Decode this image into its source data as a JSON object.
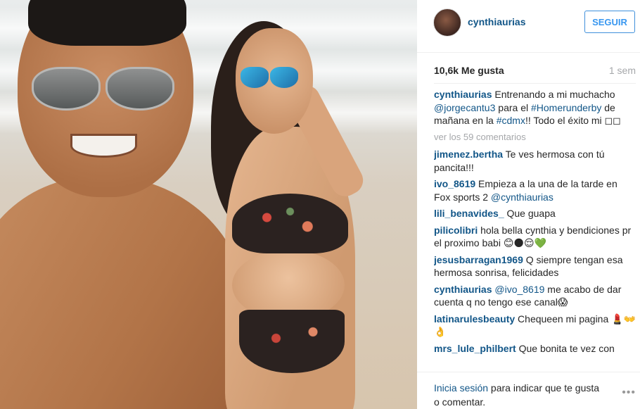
{
  "post": {
    "username": "cynthiaurias",
    "follow_label": "SEGUIR",
    "likes": "10,6k Me gusta",
    "time": "1 sem",
    "caption": {
      "user": "cynthiaurias",
      "t1": " Entrenando a mi muchacho ",
      "mention": "@jorgecantu3",
      "t2": " para el ",
      "tag1": "#Homerunderby",
      "t3": " de mañana en la ",
      "tag2": "#cdmx",
      "t4": "!! Todo el éxito mi ◻◻"
    },
    "view_all": "ver los 59 comentarios",
    "comments": [
      {
        "user": "jimenez.bertha",
        "text": " Te ves hermosa con tú pancita!!!"
      },
      {
        "user": "ivo_8619",
        "text": " Empieza a la una de la tarde en Fox sports 2 ",
        "mention": "@cynthiaurias"
      },
      {
        "user": "lili_benavides_",
        "text": " Que guapa"
      },
      {
        "user": "pilicolibri",
        "text": " hola bella cynthia y bendiciones pr el proximo babi 😊🌑😌💚"
      },
      {
        "user": "jesusbarragan1969",
        "text": " Q siempre tengan esa hermosa sonrisa, felicidades"
      },
      {
        "user": "cynthiaurias",
        "mention": " @ivo_8619",
        "text": " me acabo de dar cuenta q no tengo ese canal😱"
      },
      {
        "user": "latinarulesbeauty",
        "text": " Chequeen mi pagina 💄👐👌"
      },
      {
        "user": "mrs_lule_philbert",
        "text": " Que bonita te vez con"
      }
    ],
    "login": {
      "link": "Inicia sesión",
      "text": " para indicar que te gusta o comentar."
    },
    "more_icon": "more-dots-icon"
  }
}
